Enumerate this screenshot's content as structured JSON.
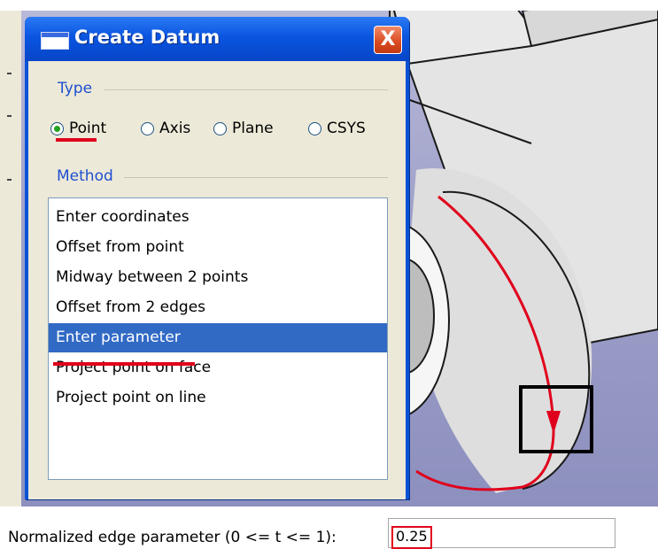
{
  "dialog": {
    "title": "Create Datum",
    "close_symbol": "X",
    "type_group_label": "Type",
    "type_options": [
      {
        "label": "Point",
        "selected": true
      },
      {
        "label": "Axis",
        "selected": false
      },
      {
        "label": "Plane",
        "selected": false
      },
      {
        "label": "CSYS",
        "selected": false
      }
    ],
    "method_group_label": "Method",
    "method_items": [
      "Enter coordinates",
      "Offset from point",
      "Midway between 2 points",
      "Offset from 2 edges",
      "Enter parameter",
      "Project point on face",
      "Project point on line"
    ],
    "selected_method": "Enter parameter"
  },
  "prompt": {
    "label": "Normalized edge parameter (0 <= t <= 1):",
    "value": "0.25"
  },
  "colors": {
    "highlight": "#e0001c",
    "selection": "#316ac5",
    "titlebar": "#0a55e0"
  },
  "icons": [
    "window-icon",
    "close-icon",
    "radio-icon",
    "arrow-icon"
  ]
}
